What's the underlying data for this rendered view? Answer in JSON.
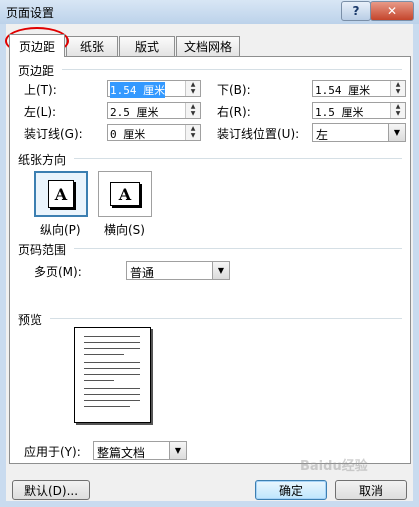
{
  "window": {
    "title": "页面设置",
    "help_label": "?"
  },
  "tabs": [
    {
      "label": "页边距",
      "active": true
    },
    {
      "label": "纸张",
      "active": false
    },
    {
      "label": "版式",
      "active": false
    },
    {
      "label": "文档网格",
      "active": false
    }
  ],
  "margins": {
    "section_label": "页边距",
    "top_label": "上(T):",
    "top_value": "1.54 厘米",
    "bottom_label": "下(B):",
    "bottom_value": "1.54 厘米",
    "left_label": "左(L):",
    "left_value": "2.5 厘米",
    "right_label": "右(R):",
    "right_value": "1.5 厘米",
    "gutter_label": "装订线(G):",
    "gutter_value": "0 厘米",
    "gutter_pos_label": "装订线位置(U):",
    "gutter_pos_value": "左"
  },
  "orientation": {
    "section_label": "纸张方向",
    "portrait_label": "纵向(P)",
    "landscape_label": "横向(S)",
    "icon_letter": "A"
  },
  "pages": {
    "section_label": "页码范围",
    "multi_label": "多页(M):",
    "multi_value": "普通"
  },
  "preview": {
    "section_label": "预览",
    "apply_label": "应用于(Y):",
    "apply_value": "整篇文档"
  },
  "buttons": {
    "default_label": "默认(D)...",
    "ok_label": "确定",
    "cancel_label": "取消"
  },
  "watermark": "Baidu经验",
  "colors": {
    "annotation": "#e00000",
    "selection": "#3399ff",
    "frame": "#c9dbef"
  }
}
